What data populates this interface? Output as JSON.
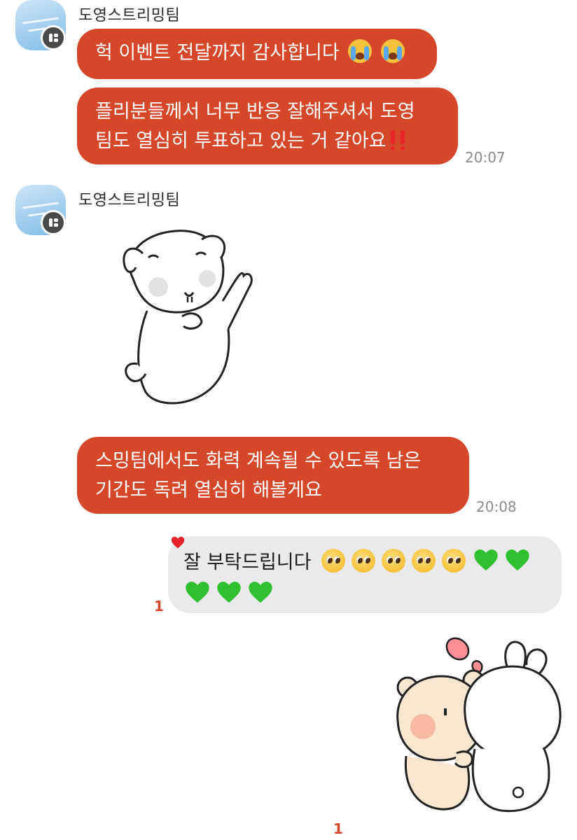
{
  "messages": {
    "group1": {
      "sender": "도영스트리밍팀",
      "bubble1": {
        "text": "헉 이벤트 전달까지 감사합니다"
      },
      "bubble2": {
        "line1": "플리분들께서 너무 반응 잘해주셔서 도영",
        "line2": "팀도 열심히 투표하고 있는 거 같아요"
      },
      "time": "20:07"
    },
    "group2": {
      "sender": "도영스트리밍팀",
      "bubble": {
        "line1": "스밍팀에서도 화력 계속될 수 있도록  남은",
        "line2": "기간도 독려 열심히 해볼게요"
      },
      "time": "20:08"
    },
    "outgoing": {
      "text": "잘 부탁드립니다",
      "unread": "1"
    },
    "sticker_out": {
      "unread": "1"
    }
  },
  "colors": {
    "incoming_bubble": "#d6472a",
    "outgoing_bubble": "#eaeaec",
    "unread_count": "#d6472a",
    "time_text": "#8a8a8a"
  },
  "icons": {
    "reaction": "heart-icon",
    "emoji_crying": "loudly-crying-face-icon",
    "emoji_pleading": "pleading-face-icon",
    "emoji_green_heart": "green-heart-icon",
    "emoji_double_exclamation": "double-exclamation-icon"
  }
}
